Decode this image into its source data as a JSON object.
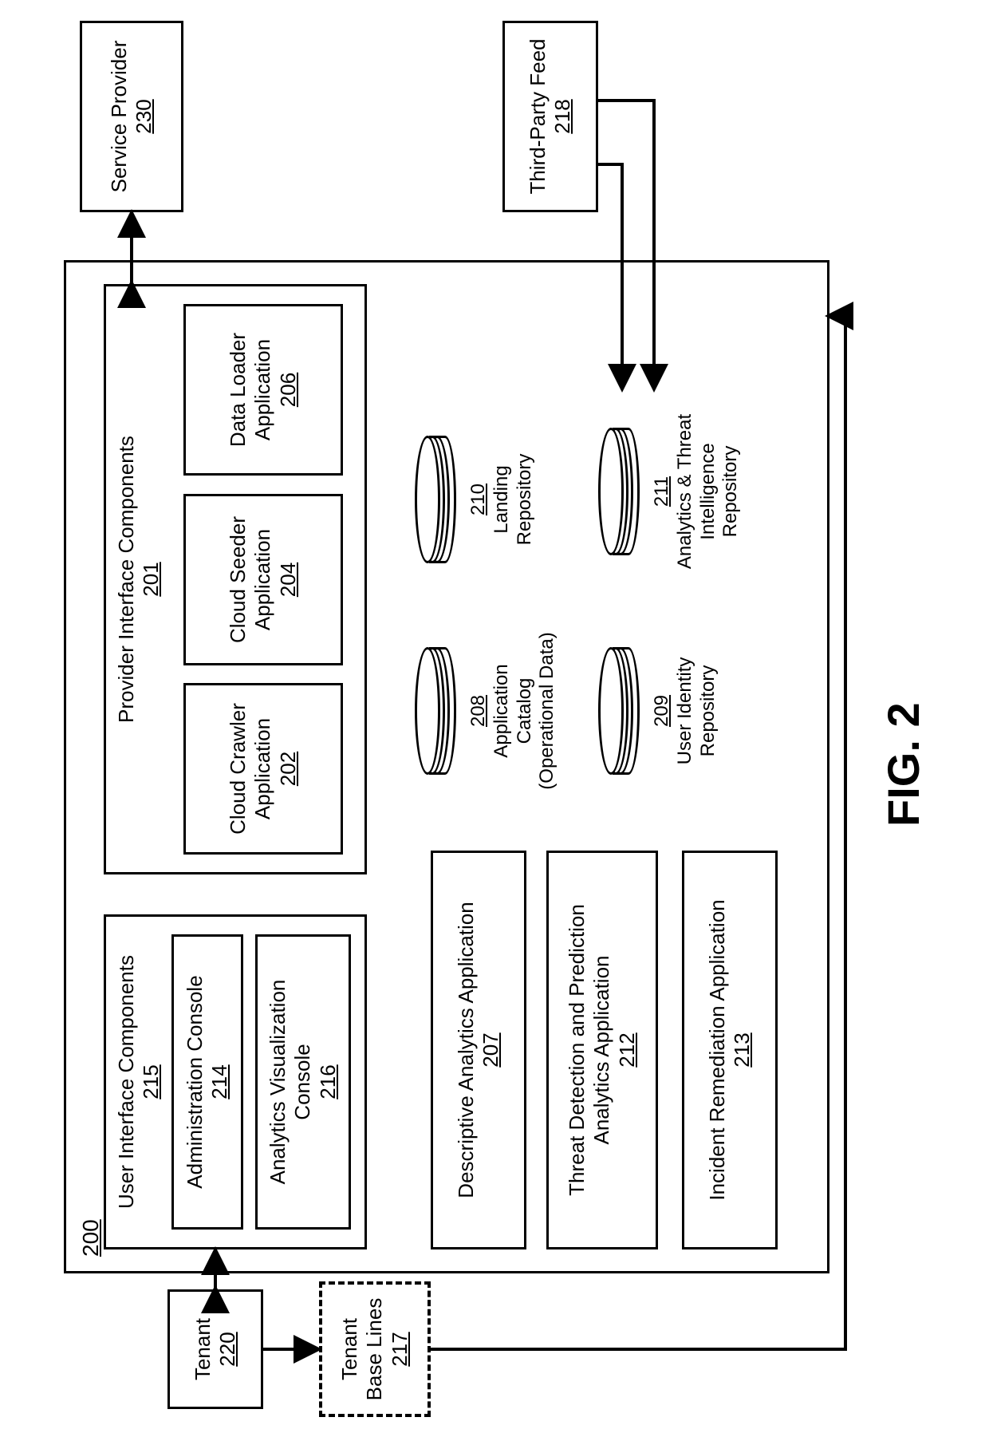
{
  "figure_label": "FIG. 2",
  "system": {
    "num": "200"
  },
  "tenant": {
    "label": "Tenant",
    "num": "220"
  },
  "tenant_baselines": {
    "line1": "Tenant",
    "line2": "Base Lines",
    "num": "217"
  },
  "service_provider": {
    "label": "Service Provider",
    "num": "230"
  },
  "third_party": {
    "label": "Third-Party Feed",
    "num": "218"
  },
  "ui_components": {
    "title": "User Interface Components",
    "num": "215",
    "admin": {
      "label": "Administration Console",
      "num": "214"
    },
    "viz": {
      "line1": "Analytics Visualization",
      "line2": "Console",
      "num": "216"
    }
  },
  "provider_components": {
    "title": "Provider Interface Components",
    "num": "201",
    "crawler": {
      "line1": "Cloud Crawler",
      "line2": "Application",
      "num": "202"
    },
    "seeder": {
      "line1": "Cloud Seeder",
      "line2": "Application",
      "num": "204"
    },
    "loader": {
      "line1": "Data Loader",
      "line2": "Application",
      "num": "206"
    }
  },
  "apps": {
    "descriptive": {
      "label": "Descriptive Analytics Application",
      "num": "207"
    },
    "threat": {
      "line1": "Threat Detection and Prediction",
      "line2": "Analytics Application",
      "num": "212"
    },
    "incident": {
      "label": "Incident Remediation Application",
      "num": "213"
    }
  },
  "db": {
    "catalog": {
      "num": "208",
      "line1": "Application",
      "line2": "Catalog",
      "line3": "(Operational Data)"
    },
    "landing": {
      "num": "210",
      "line1": "Landing",
      "line2": "Repository"
    },
    "identity": {
      "num": "209",
      "line1": "User Identity",
      "line2": "Repository"
    },
    "analytics": {
      "num": "211",
      "line1": "Analytics & Threat",
      "line2": "Intelligence",
      "line3": "Repository"
    }
  }
}
